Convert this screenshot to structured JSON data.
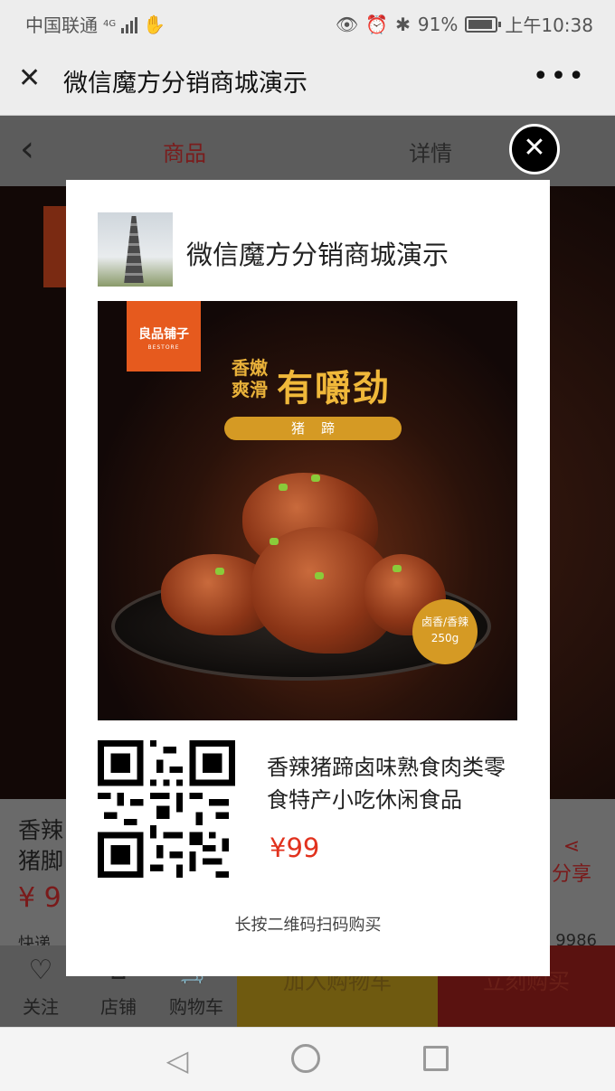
{
  "status": {
    "carrier": "中国联通",
    "network": "4G",
    "battery": "91%",
    "time": "上午10:38"
  },
  "header": {
    "title": "微信魔方分销商城演示",
    "close_icon": "close-icon",
    "more_icon": "more-icon"
  },
  "background_page": {
    "tabs": [
      "商品",
      "详情"
    ],
    "product_name_partial": "香辣猪脚",
    "price_partial": "¥ 9",
    "share_label": "分享",
    "express_label": "快递",
    "sales_partial": "9986",
    "bottom": {
      "follow": "关注",
      "shop": "店铺",
      "cart": "购物车",
      "add_to_cart": "加入购物车",
      "buy_now": "立刻购买"
    }
  },
  "poster": {
    "shop_name": "微信魔方分销商城演示",
    "image": {
      "brand_logo": "良品铺子",
      "brand_logo_en": "BESTORE",
      "slogan_small": "香嫩\n爽滑",
      "slogan_large": "有嚼劲",
      "label": "猪蹄",
      "flavor_tag": "卤香/香辣",
      "weight_tag": "250g"
    },
    "product_name": "香辣猪蹄卤味熟食肉类零食特产小吃休闲食品",
    "price": "¥99",
    "hint": "长按二维码扫码购买"
  },
  "colors": {
    "price": "#e1321e",
    "brand_orange": "#e65a1e",
    "gold": "#d59a24"
  }
}
